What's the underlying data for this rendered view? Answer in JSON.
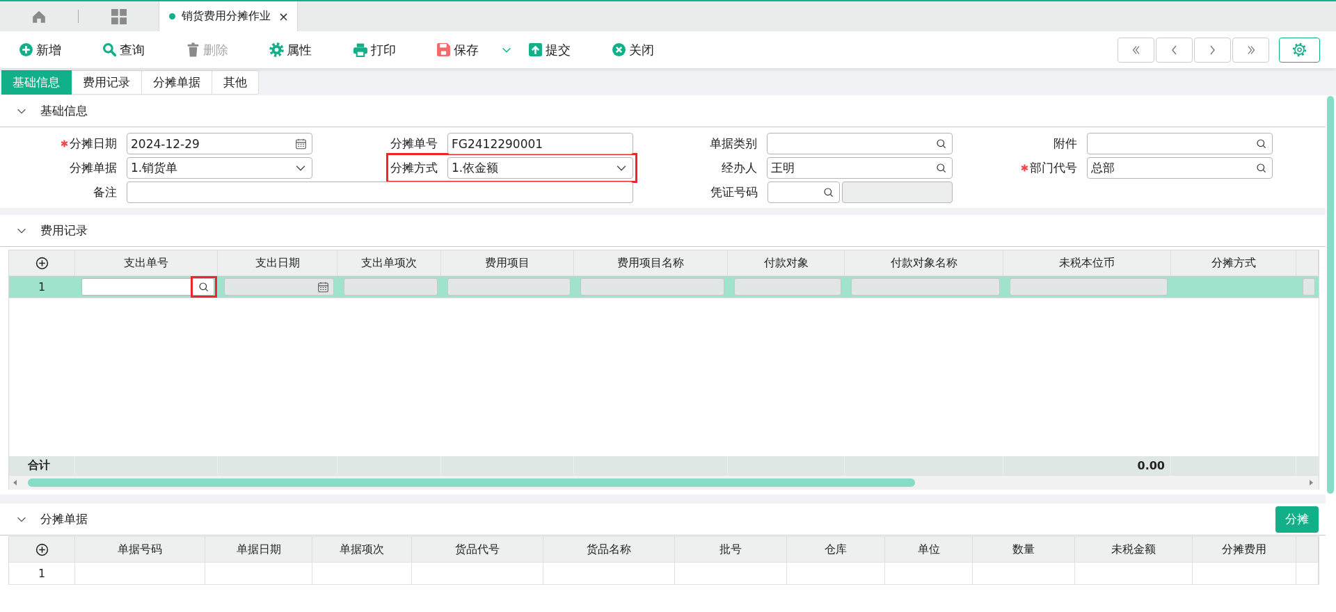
{
  "top_tabs": [
    {
      "kind": "home",
      "selected": false
    },
    {
      "kind": "apps",
      "selected": false
    },
    {
      "kind": "page",
      "label": "销货费用分摊作业",
      "close": "×",
      "selected": true
    }
  ],
  "toolbar": {
    "buttons": [
      {
        "kind": "add",
        "label": "新增",
        "disabled": false,
        "dropdown": false
      },
      {
        "kind": "search",
        "label": "查询",
        "disabled": false,
        "dropdown": false
      },
      {
        "kind": "delete",
        "label": "删除",
        "disabled": true,
        "dropdown": false
      },
      {
        "kind": "properties",
        "label": "属性",
        "disabled": false,
        "dropdown": false
      },
      {
        "kind": "print",
        "label": "打印",
        "disabled": false,
        "dropdown": false
      },
      {
        "kind": "save",
        "label": "保存",
        "disabled": false,
        "dropdown": true
      },
      {
        "kind": "submit",
        "label": "提交",
        "disabled": false,
        "dropdown": false
      },
      {
        "kind": "close",
        "label": "关闭",
        "disabled": false,
        "dropdown": false
      }
    ],
    "nav_buttons": [
      {
        "kind": "first"
      },
      {
        "kind": "previous"
      },
      {
        "kind": "next"
      },
      {
        "kind": "last"
      }
    ],
    "settings_button": {
      "kind": "settings"
    }
  },
  "form_tabs": [
    {
      "label": "基础信息",
      "selected": true
    },
    {
      "label": "费用记录",
      "selected": false
    },
    {
      "label": "分摊单据",
      "selected": false
    },
    {
      "label": "其他",
      "selected": false
    }
  ],
  "basic_info": {
    "title": "基础信息",
    "expanded": true,
    "fields": [
      {
        "label": "分摊日期",
        "required": true,
        "kind": "date",
        "value": "2024-12-29",
        "highlighted": false
      },
      {
        "label": "分摊单号",
        "required": false,
        "kind": "text",
        "value": "FG2412290001",
        "highlighted": false
      },
      {
        "label": "单据类别",
        "required": false,
        "kind": "lookup",
        "highlighted": false
      },
      {
        "label": "附件",
        "required": false,
        "kind": "lookup",
        "highlighted": false
      },
      {
        "label": "分摊单据",
        "required": false,
        "kind": "select",
        "value": "1.销货单",
        "highlighted": false
      },
      {
        "label": "分摊方式",
        "required": false,
        "kind": "select",
        "value": "1.依金额",
        "highlighted": true
      },
      {
        "label": "经办人",
        "required": false,
        "kind": "lookup",
        "value": "王明",
        "highlighted": false
      },
      {
        "label": "部门代号",
        "required": true,
        "kind": "lookup",
        "value": "总部",
        "highlighted": false
      },
      {
        "label": "备注",
        "required": false,
        "kind": "memo",
        "highlighted": false
      },
      {
        "label": "凭证号码",
        "required": false,
        "kind": "lookup_pair",
        "highlighted": false
      }
    ]
  },
  "expense_records": {
    "title": "费用记录",
    "expanded": true,
    "columns": [
      "支出单号",
      "支出日期",
      "支出单项次",
      "费用项目",
      "费用项目名称",
      "付款对象",
      "付款对象名称",
      "未税本位币",
      "分摊方式"
    ],
    "rows": [
      {
        "number": "1",
        "selected": true,
        "cells": [
          {
            "kind": "lookup",
            "disabled": false,
            "highlighted": true
          },
          {
            "kind": "date",
            "disabled": true
          },
          {
            "kind": "text",
            "disabled": true
          },
          {
            "kind": "text",
            "disabled": true
          },
          {
            "kind": "text",
            "disabled": true
          },
          {
            "kind": "text",
            "disabled": true
          },
          {
            "kind": "text",
            "disabled": true
          },
          {
            "kind": "text",
            "disabled": true
          },
          {
            "kind": "empty"
          },
          {
            "kind": "text",
            "disabled": true
          }
        ]
      }
    ],
    "total_row": {
      "label": "合计",
      "amount": "0.00"
    }
  },
  "allocation_docs": {
    "title": "分摊单据",
    "expanded": true,
    "action": "分摊",
    "columns": [
      "单据号码",
      "单据日期",
      "单据项次",
      "货品代号",
      "货品名称",
      "批号",
      "仓库",
      "单位",
      "数量",
      "未税金额",
      "分摊费用"
    ],
    "rows": [
      {
        "number": "1",
        "selected": false
      }
    ]
  }
}
